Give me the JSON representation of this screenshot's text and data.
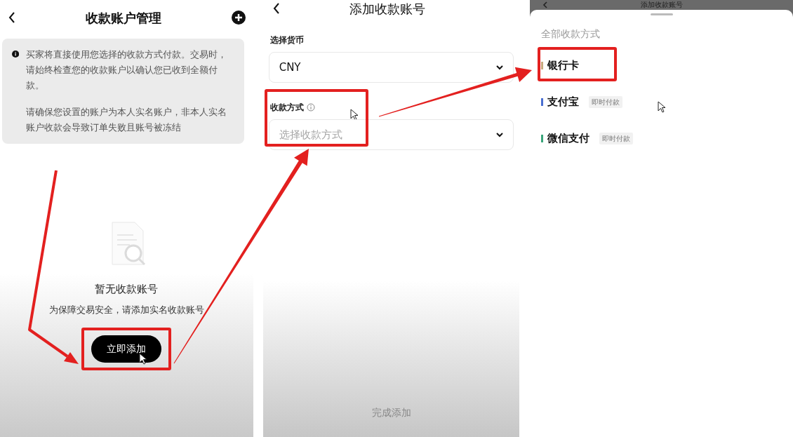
{
  "account_list": {
    "title": "收款账户管理",
    "notice": [
      "买家将直接使用您选择的收款方式付款。交易时，请始终检查您的收款账户以确认您已收到全额付款。",
      "请确保您设置的账户为本人实名账户，非本人实名账户收款会导致订单失败且账号被冻结"
    ],
    "empty_title": "暂无收款账号",
    "empty_hint": "为保障交易安全，请添加实名收款账号",
    "button": "立即添加"
  },
  "add_account": {
    "title": "添加收款账号",
    "fields": [
      {
        "label": "选择货币",
        "value": "CNY",
        "hint_icon": false
      },
      {
        "label": "收款方式",
        "placeholder": "选择收款方式",
        "hint_icon": true
      }
    ],
    "button": {
      "label": "完成添加",
      "disabled": true
    }
  },
  "method_sheet": {
    "header_title": "添加收款账号",
    "sheet_title": "全部收款方式",
    "options": [
      {
        "name": "银行卡",
        "color": "#c8a97e"
      },
      {
        "name": "支付宝",
        "tag": "即时付款",
        "color": "#4a6fd1"
      },
      {
        "name": "微信支付",
        "tag": "即时付款",
        "color": "#3aa57a"
      }
    ]
  }
}
